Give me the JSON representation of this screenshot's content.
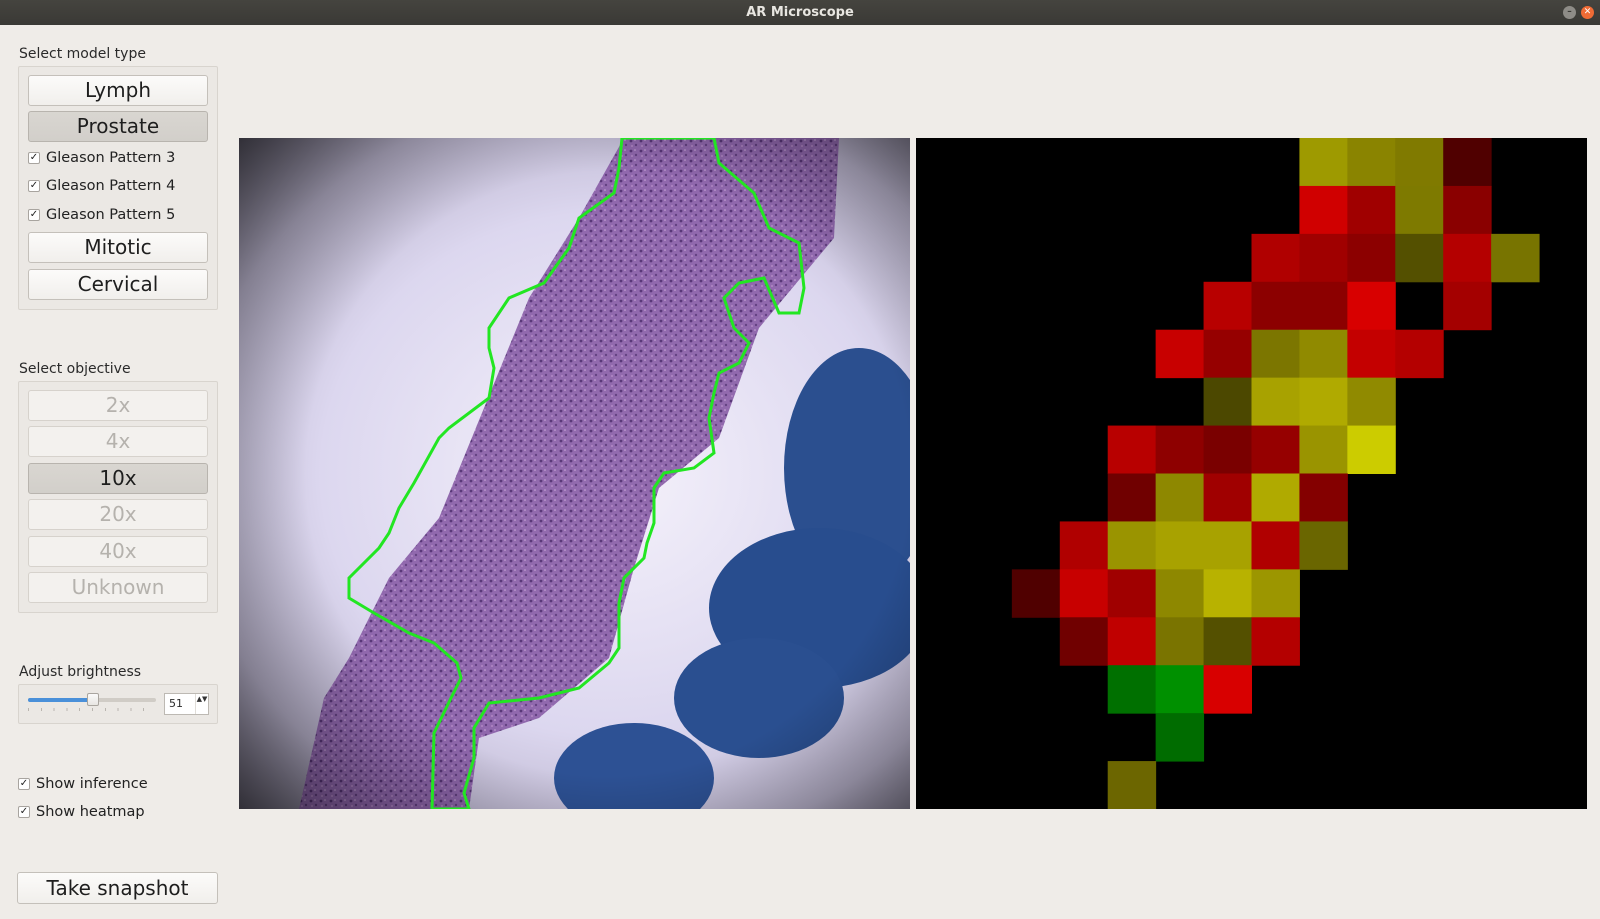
{
  "window": {
    "title": "AR Microscope",
    "minimize_glyph": "–",
    "close_glyph": "✕"
  },
  "model": {
    "label": "Select model type",
    "buttons": [
      {
        "label": "Lymph",
        "active": false
      },
      {
        "label": "Prostate",
        "active": true
      },
      {
        "label": "Mitotic",
        "active": false
      },
      {
        "label": "Cervical",
        "active": false
      }
    ],
    "patterns": [
      {
        "label": "Gleason Pattern 3",
        "checked": true
      },
      {
        "label": "Gleason Pattern 4",
        "checked": true
      },
      {
        "label": "Gleason Pattern 5",
        "checked": true
      }
    ]
  },
  "objective": {
    "label": "Select objective",
    "options": [
      {
        "label": "2x",
        "state": "disabled"
      },
      {
        "label": "4x",
        "state": "disabled"
      },
      {
        "label": "10x",
        "state": "active"
      },
      {
        "label": "20x",
        "state": "disabled"
      },
      {
        "label": "40x",
        "state": "disabled"
      },
      {
        "label": "Unknown",
        "state": "disabled"
      }
    ]
  },
  "brightness": {
    "label": "Adjust brightness",
    "value": "51",
    "min": 0,
    "max": 100,
    "spin_arrows": "▲▼"
  },
  "display": {
    "show_inference": {
      "label": "Show inference",
      "checked": true
    },
    "show_heatmap": {
      "label": "Show heatmap",
      "checked": true
    }
  },
  "snapshot_label": "Take snapshot",
  "check_glyph": "✓",
  "colors": {
    "accent": "#4a90d9",
    "contour": "#22e622",
    "tissue": "#8a5fa8",
    "ink_blue": "#2b4f8f",
    "heat_red": "#cc0000",
    "heat_yellow": "#c8c800",
    "heat_green": "#008800"
  },
  "heatmap": {
    "rows": 14,
    "cols": 14,
    "cells": [
      [
        0,
        8,
        "#9e9a00"
      ],
      [
        0,
        9,
        "#8a8400"
      ],
      [
        0,
        10,
        "#807a00"
      ],
      [
        0,
        11,
        "#500000"
      ],
      [
        1,
        8,
        "#d00000"
      ],
      [
        1,
        9,
        "#a00000"
      ],
      [
        1,
        10,
        "#7e7a00"
      ],
      [
        1,
        11,
        "#8a0000"
      ],
      [
        2,
        7,
        "#b00000"
      ],
      [
        2,
        8,
        "#a00000"
      ],
      [
        2,
        9,
        "#8c0000"
      ],
      [
        2,
        10,
        "#545000"
      ],
      [
        2,
        11,
        "#b40000"
      ],
      [
        2,
        12,
        "#787400"
      ],
      [
        3,
        6,
        "#b80000"
      ],
      [
        3,
        7,
        "#8c0000"
      ],
      [
        3,
        8,
        "#8c0000"
      ],
      [
        3,
        9,
        "#d80000"
      ],
      [
        3,
        11,
        "#a40000"
      ],
      [
        4,
        5,
        "#c80000"
      ],
      [
        4,
        6,
        "#960000"
      ],
      [
        4,
        7,
        "#7c7600"
      ],
      [
        4,
        8,
        "#908a00"
      ],
      [
        4,
        9,
        "#c40000"
      ],
      [
        4,
        10,
        "#b40000"
      ],
      [
        5,
        6,
        "#4c4800"
      ],
      [
        5,
        7,
        "#a8a200"
      ],
      [
        5,
        8,
        "#b0aa00"
      ],
      [
        5,
        9,
        "#908a00"
      ],
      [
        6,
        4,
        "#b80000"
      ],
      [
        6,
        5,
        "#8e0000"
      ],
      [
        6,
        6,
        "#7a0000"
      ],
      [
        6,
        7,
        "#960000"
      ],
      [
        6,
        8,
        "#9a9400"
      ],
      [
        6,
        9,
        "#cccc00"
      ],
      [
        7,
        4,
        "#700000"
      ],
      [
        7,
        5,
        "#8e8800"
      ],
      [
        7,
        6,
        "#a00000"
      ],
      [
        7,
        7,
        "#b0aa00"
      ],
      [
        7,
        8,
        "#840000"
      ],
      [
        8,
        3,
        "#b00000"
      ],
      [
        8,
        4,
        "#9a9400"
      ],
      [
        8,
        5,
        "#a8a200"
      ],
      [
        8,
        6,
        "#a8a200"
      ],
      [
        8,
        7,
        "#b00000"
      ],
      [
        8,
        8,
        "#6a6600"
      ],
      [
        9,
        2,
        "#500000"
      ],
      [
        9,
        3,
        "#c80000"
      ],
      [
        9,
        4,
        "#a00000"
      ],
      [
        9,
        5,
        "#8e8800"
      ],
      [
        9,
        6,
        "#b8b200"
      ],
      [
        9,
        7,
        "#9c9600"
      ],
      [
        10,
        3,
        "#700000"
      ],
      [
        10,
        4,
        "#c00000"
      ],
      [
        10,
        5,
        "#7a7400"
      ],
      [
        10,
        6,
        "#545000"
      ],
      [
        10,
        7,
        "#b40000"
      ],
      [
        11,
        4,
        "#007000"
      ],
      [
        11,
        5,
        "#009000"
      ],
      [
        11,
        6,
        "#d80000"
      ],
      [
        12,
        5,
        "#006c00"
      ],
      [
        13,
        4,
        "#6c6600"
      ]
    ]
  }
}
